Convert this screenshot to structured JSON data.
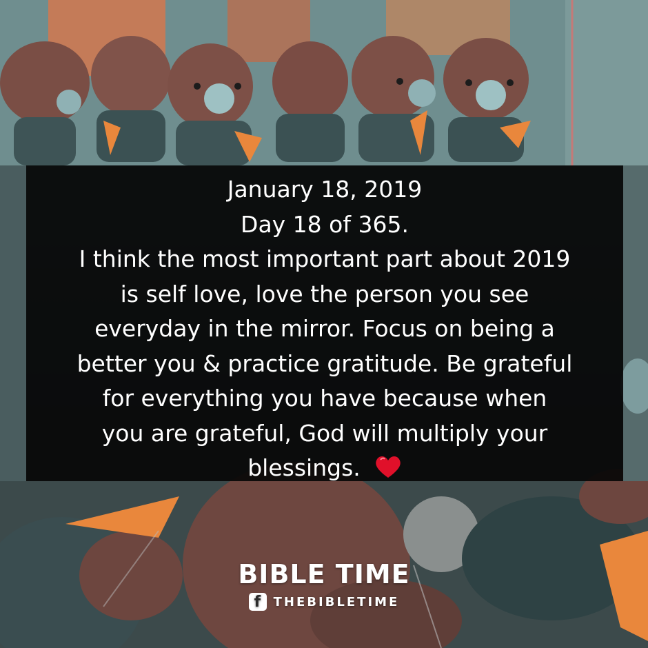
{
  "post": {
    "date": "January 18, 2019",
    "day": "Day 18 of 365.",
    "lines": [
      "I think the most important part about 2019",
      "is self love, love the person you see",
      "everyday in the mirror. Focus on being a",
      "better you & practice gratitude. Be grateful",
      "for everything you have because when",
      "you are grateful, God will multiply your",
      "blessings."
    ],
    "emoji": "heart-icon"
  },
  "brand": {
    "title": "BIBLE TIME",
    "social_handle": "THEBIBLETIME",
    "social_icon": "facebook-icon"
  },
  "colors": {
    "panel": "#080808",
    "text": "#ffffff",
    "heart": "#e0102a",
    "plush": "#7a4e45",
    "shirt": "#3e5456",
    "accent": "#e9873c"
  }
}
